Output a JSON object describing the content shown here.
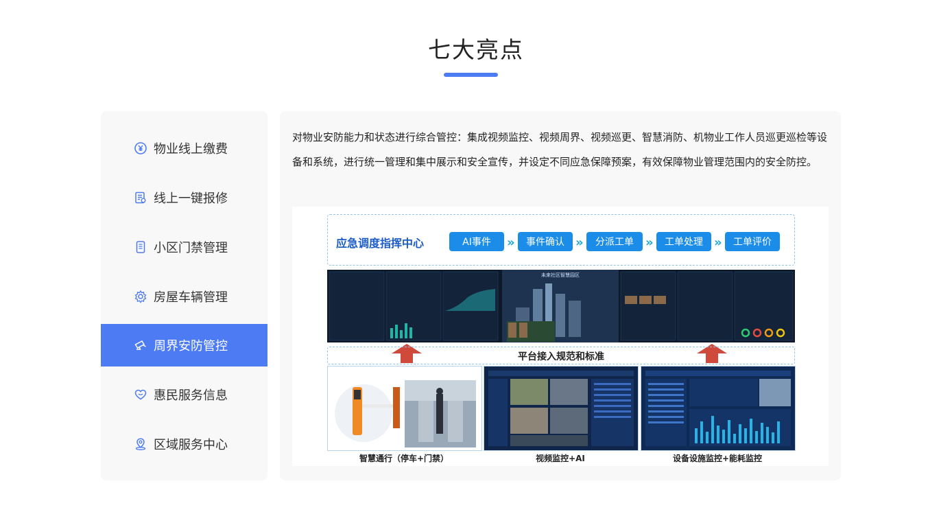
{
  "section": {
    "title": "七大亮点"
  },
  "sidebar": {
    "items": [
      {
        "label": "物业线上缴费",
        "icon": "yen-circle-icon"
      },
      {
        "label": "线上一键报修",
        "icon": "repair-form-icon"
      },
      {
        "label": "小区门禁管理",
        "icon": "access-card-icon"
      },
      {
        "label": "房屋车辆管理",
        "icon": "gear-icon"
      },
      {
        "label": "周界安防管控",
        "icon": "camera-icon"
      },
      {
        "label": "惠民服务信息",
        "icon": "heart-chat-icon"
      },
      {
        "label": "区域服务中心",
        "icon": "location-pin-icon"
      }
    ],
    "active_index": 4
  },
  "content": {
    "description": "对物业安防能力和状态进行综合管控：集成视频监控、视频周界、视频巡更、智慧消防、机物业工作人员巡更巡检等设备和系统，进行统一管理和集中展示和安全宣传，并设定不同应急保障预案，有效保障物业管理范围内的安全防控。",
    "diagram": {
      "center_title": "应急调度指挥中心",
      "steps": [
        "AI事件",
        "事件确认",
        "分派工单",
        "工单处理",
        "工单评价"
      ],
      "dashboard_title": "未来社区智慧园区",
      "platform_label": "平台接入规范和标准",
      "panels": [
        "智慧通行（停车+门禁）",
        "视频监控+AI",
        "设备设施监控+能耗监控"
      ]
    }
  },
  "colors": {
    "accent": "#4d7bf3",
    "step_blue": "#1b8de8",
    "arrow_red": "#cf4a3b"
  }
}
